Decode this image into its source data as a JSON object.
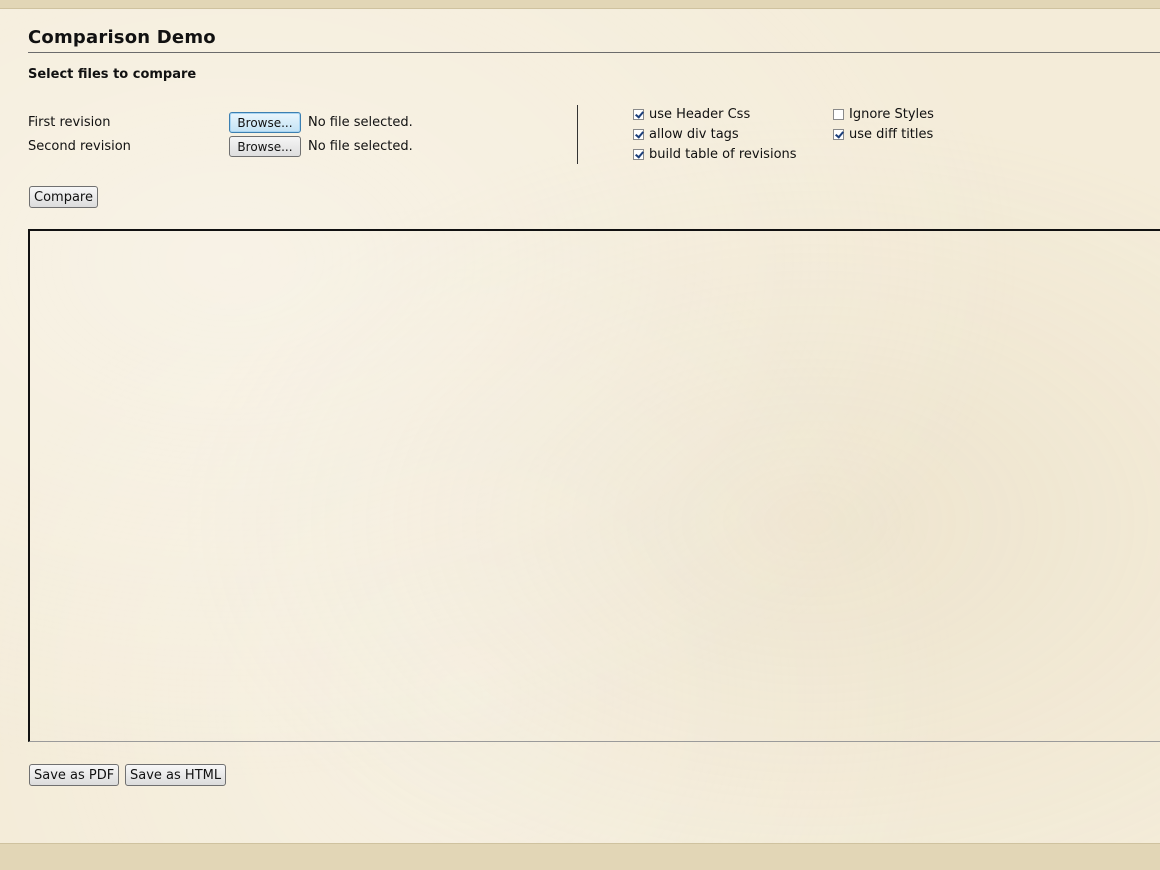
{
  "header": {
    "title": "Comparison Demo"
  },
  "files": {
    "heading": "Select files to compare",
    "first": {
      "label": "First revision",
      "browse_label": "Browse...",
      "status": "No file selected."
    },
    "second": {
      "label": "Second revision",
      "browse_label": "Browse...",
      "status": "No file selected."
    }
  },
  "options": {
    "use_header_css": {
      "label": "use Header Css",
      "checked": true
    },
    "allow_div_tags": {
      "label": "allow div tags",
      "checked": true
    },
    "build_table": {
      "label": "build table of revisions",
      "checked": true
    },
    "ignore_styles": {
      "label": "Ignore Styles",
      "checked": false
    },
    "use_diff_titles": {
      "label": "use diff titles",
      "checked": true
    }
  },
  "actions": {
    "compare_label": "Compare",
    "save_pdf_label": "Save as PDF",
    "save_html_label": "Save as HTML"
  },
  "colors": {
    "background": "#f4ecd9",
    "band": "#e2d6b6",
    "text": "#111111"
  }
}
